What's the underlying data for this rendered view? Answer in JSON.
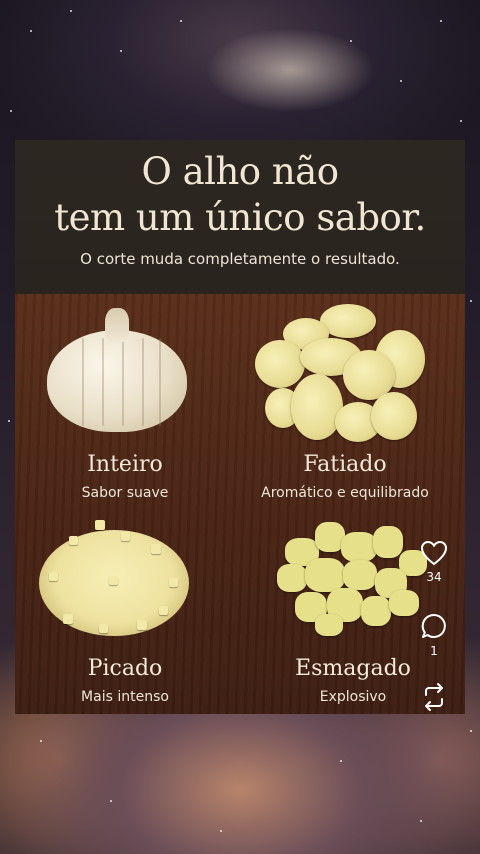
{
  "post": {
    "title_line1": "O alho não",
    "title_line2": "tem um único sabor.",
    "subtitle": "O corte muda completamente o resultado."
  },
  "cuts": [
    {
      "name": "Inteiro",
      "description": "Sabor suave"
    },
    {
      "name": "Fatiado",
      "description": "Aromático e equilibrado"
    },
    {
      "name": "Picado",
      "description": "Mais intenso"
    },
    {
      "name": "Esmagado",
      "description": "Explosivo"
    }
  ],
  "actions": {
    "like_count": "34",
    "comment_count": "1",
    "like_icon": "heart-icon",
    "comment_icon": "comment-icon",
    "repost_icon": "repost-icon"
  },
  "colors": {
    "title": "#f1e6d2",
    "header_bg": "#2d2722",
    "board_wood": "#4a2414"
  }
}
